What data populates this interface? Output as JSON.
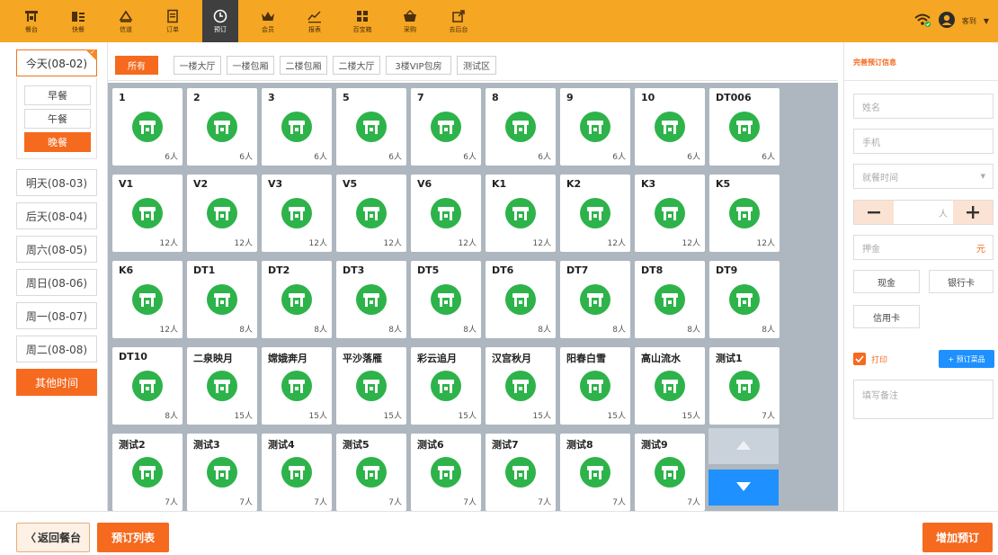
{
  "nav": [
    {
      "label": "餐台",
      "icon": "table-icon"
    },
    {
      "label": "快餐",
      "icon": "fastfood-icon"
    },
    {
      "label": "信道",
      "icon": "bell-icon"
    },
    {
      "label": "订单",
      "icon": "order-icon"
    },
    {
      "label": "预订",
      "icon": "clock-icon",
      "active": true
    },
    {
      "label": "会员",
      "icon": "crown-icon"
    },
    {
      "label": "报表",
      "icon": "chart-icon"
    },
    {
      "label": "百宝箱",
      "icon": "grid-icon"
    },
    {
      "label": "采购",
      "icon": "basket-icon"
    },
    {
      "label": "去后台",
      "icon": "external-icon"
    }
  ],
  "user": {
    "name": "客到"
  },
  "dates": [
    {
      "label": "今天(08-02)",
      "selected": true
    },
    {
      "label": "明天(08-03)"
    },
    {
      "label": "后天(08-04)"
    },
    {
      "label": "周六(08-05)"
    },
    {
      "label": "周日(08-06)"
    },
    {
      "label": "周一(08-07)"
    },
    {
      "label": "周二(08-08)"
    }
  ],
  "meals": [
    {
      "label": "早餐"
    },
    {
      "label": "午餐"
    },
    {
      "label": "晚餐",
      "selected": true
    }
  ],
  "other_time_label": "其他时间",
  "filters": [
    {
      "label": "所有",
      "selected": true
    },
    {
      "label": "一楼大厅"
    },
    {
      "label": "一楼包厢"
    },
    {
      "label": "二楼包厢"
    },
    {
      "label": "二楼大厅"
    },
    {
      "label": "3楼VIP包房"
    },
    {
      "label": "测试区"
    }
  ],
  "tables": [
    [
      {
        "name": "1",
        "people": "6人"
      },
      {
        "name": "2",
        "people": "6人"
      },
      {
        "name": "3",
        "people": "6人"
      },
      {
        "name": "5",
        "people": "6人"
      },
      {
        "name": "7",
        "people": "6人"
      },
      {
        "name": "8",
        "people": "6人"
      },
      {
        "name": "9",
        "people": "6人"
      },
      {
        "name": "10",
        "people": "6人"
      },
      {
        "name": "DT006",
        "people": "6人"
      }
    ],
    [
      {
        "name": "V1",
        "people": "12人"
      },
      {
        "name": "V2",
        "people": "12人"
      },
      {
        "name": "V3",
        "people": "12人"
      },
      {
        "name": "V5",
        "people": "12人"
      },
      {
        "name": "V6",
        "people": "12人"
      },
      {
        "name": "K1",
        "people": "12人"
      },
      {
        "name": "K2",
        "people": "12人"
      },
      {
        "name": "K3",
        "people": "12人"
      },
      {
        "name": "K5",
        "people": "12人"
      }
    ],
    [
      {
        "name": "K6",
        "people": "12人"
      },
      {
        "name": "DT1",
        "people": "8人"
      },
      {
        "name": "DT2",
        "people": "8人"
      },
      {
        "name": "DT3",
        "people": "8人"
      },
      {
        "name": "DT5",
        "people": "8人"
      },
      {
        "name": "DT6",
        "people": "8人"
      },
      {
        "name": "DT7",
        "people": "8人"
      },
      {
        "name": "DT8",
        "people": "8人"
      },
      {
        "name": "DT9",
        "people": "8人"
      }
    ],
    [
      {
        "name": "DT10",
        "people": "8人"
      },
      {
        "name": "二泉映月",
        "people": "15人"
      },
      {
        "name": "嫦娥奔月",
        "people": "15人"
      },
      {
        "name": "平沙落雁",
        "people": "15人"
      },
      {
        "name": "彩云追月",
        "people": "15人"
      },
      {
        "name": "汉宫秋月",
        "people": "15人"
      },
      {
        "name": "阳春白雪",
        "people": "15人"
      },
      {
        "name": "高山流水",
        "people": "15人"
      },
      {
        "name": "测试1",
        "people": "7人"
      }
    ],
    [
      {
        "name": "测试2",
        "people": "7人"
      },
      {
        "name": "测试3",
        "people": "7人"
      },
      {
        "name": "测试4",
        "people": "7人"
      },
      {
        "name": "测试5",
        "people": "7人"
      },
      {
        "name": "测试6",
        "people": "7人"
      },
      {
        "name": "测试7",
        "people": "7人"
      },
      {
        "name": "测试8",
        "people": "7人"
      },
      {
        "name": "测试9",
        "people": "7人"
      }
    ]
  ],
  "form": {
    "title": "完善预订信息",
    "name_placeholder": "姓名",
    "phone_placeholder": "手机",
    "time_placeholder": "就餐时间",
    "people_unit": "人",
    "deposit_placeholder": "押金",
    "deposit_unit": "元",
    "pay_cash": "现金",
    "pay_bank": "银行卡",
    "pay_credit": "信用卡",
    "print_label": "打印",
    "print_checked": true,
    "order_dish_label": "+ 预订菜品",
    "note_placeholder": "填写备注"
  },
  "footer": {
    "back_label": "返回餐台",
    "list_label": "预订列表",
    "add_label": "增加预订"
  },
  "colors": {
    "accent": "#f56a1e",
    "topbar": "#f5a623",
    "table_green": "#2db34a",
    "scroll_blue": "#1e90ff"
  }
}
